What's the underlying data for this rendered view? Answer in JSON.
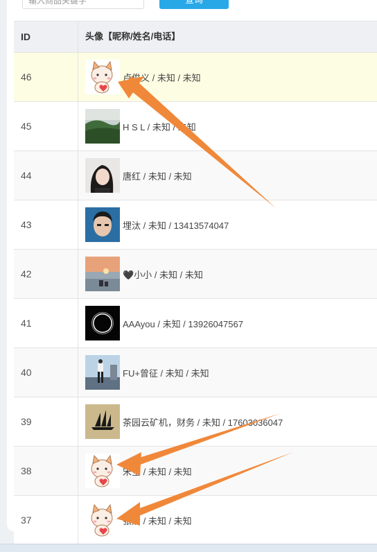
{
  "search": {
    "placeholder": "输入商品关键字",
    "button_label": "查询"
  },
  "table": {
    "headers": {
      "id": "ID",
      "user": "头像【昵称/姓名/电话】"
    },
    "rows": [
      {
        "id": "46",
        "user": "卢俊义 / 未知 / 未知",
        "avatar": "cat-avatar"
      },
      {
        "id": "45",
        "user": "H S L / 未知 / 未知",
        "avatar": "landscape-avatar"
      },
      {
        "id": "44",
        "user": "唐红 / 未知 / 未知",
        "avatar": "woman-photo-avatar"
      },
      {
        "id": "43",
        "user": "埋汰 / 未知 / 13413574047",
        "avatar": "man-photo-avatar"
      },
      {
        "id": "42",
        "user": "🖤小小 / 未知 / 未知",
        "avatar": "sunset-avatar"
      },
      {
        "id": "41",
        "user": "AAAyou / 未知 / 13926047567",
        "avatar": "eclipse-avatar"
      },
      {
        "id": "40",
        "user": "FU+曾征 / 未知 / 未知",
        "avatar": "city-photo-avatar"
      },
      {
        "id": "39",
        "user": "茶园云矿机，财务 / 未知 / 17603036047",
        "avatar": "ship-avatar"
      },
      {
        "id": "38",
        "user": "宋全 / 未知 / 未知",
        "avatar": "cat-avatar"
      },
      {
        "id": "37",
        "user": "张清 / 未知 / 未知",
        "avatar": "cat-avatar"
      }
    ]
  },
  "colors": {
    "arrow": "#f0883a",
    "accent": "#29a8e8",
    "highlight_row": "#fdfde3"
  }
}
